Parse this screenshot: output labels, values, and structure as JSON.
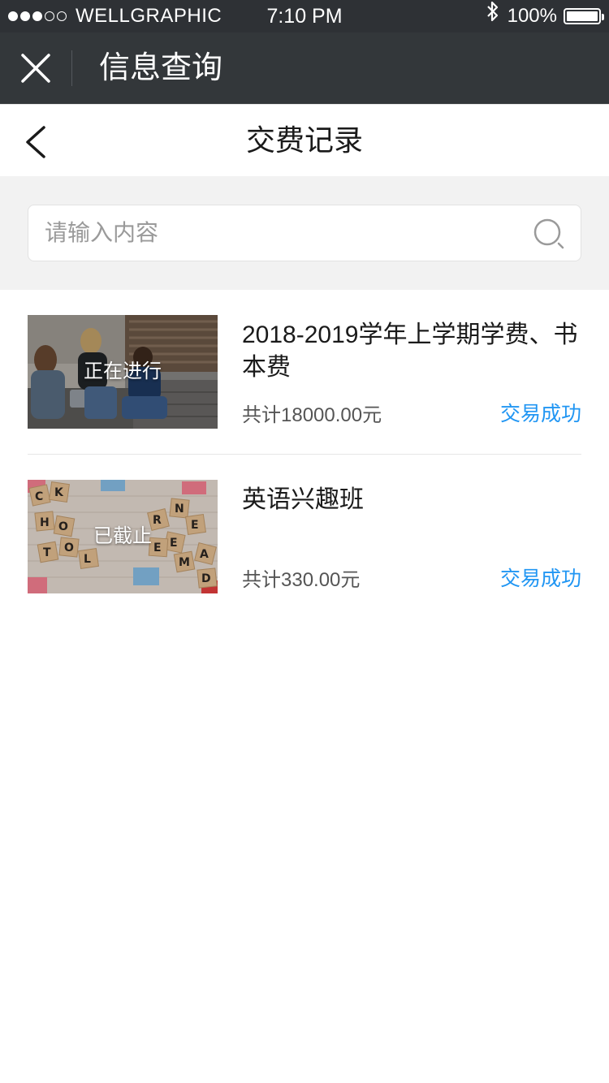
{
  "status_bar": {
    "carrier": "WELLGRAPHIC",
    "time": "7:10 PM",
    "battery": "100%",
    "signal_bars": 3,
    "signal_total": 5
  },
  "app_header": {
    "title": "信息查询",
    "close_icon": "close-icon"
  },
  "nav": {
    "title": "交费记录",
    "back_icon": "chevron-left-icon"
  },
  "search": {
    "placeholder": "请输入内容",
    "value": "",
    "icon": "search-icon"
  },
  "records": [
    {
      "title": "2018-2019学年上学期学费、书本费",
      "badge": "正在进行",
      "total": "共计18000.00元",
      "status": "交易成功",
      "image": "students-photo"
    },
    {
      "title": "英语兴趣班",
      "badge": "已截止",
      "total": "共计330.00元",
      "status": "交易成功",
      "image": "scrabble-tiles-photo"
    }
  ],
  "colors": {
    "status_bar_bg": "#2e3135",
    "header_bg": "#33373a",
    "accent": "#2196f3",
    "search_area_bg": "#f2f2f2"
  }
}
